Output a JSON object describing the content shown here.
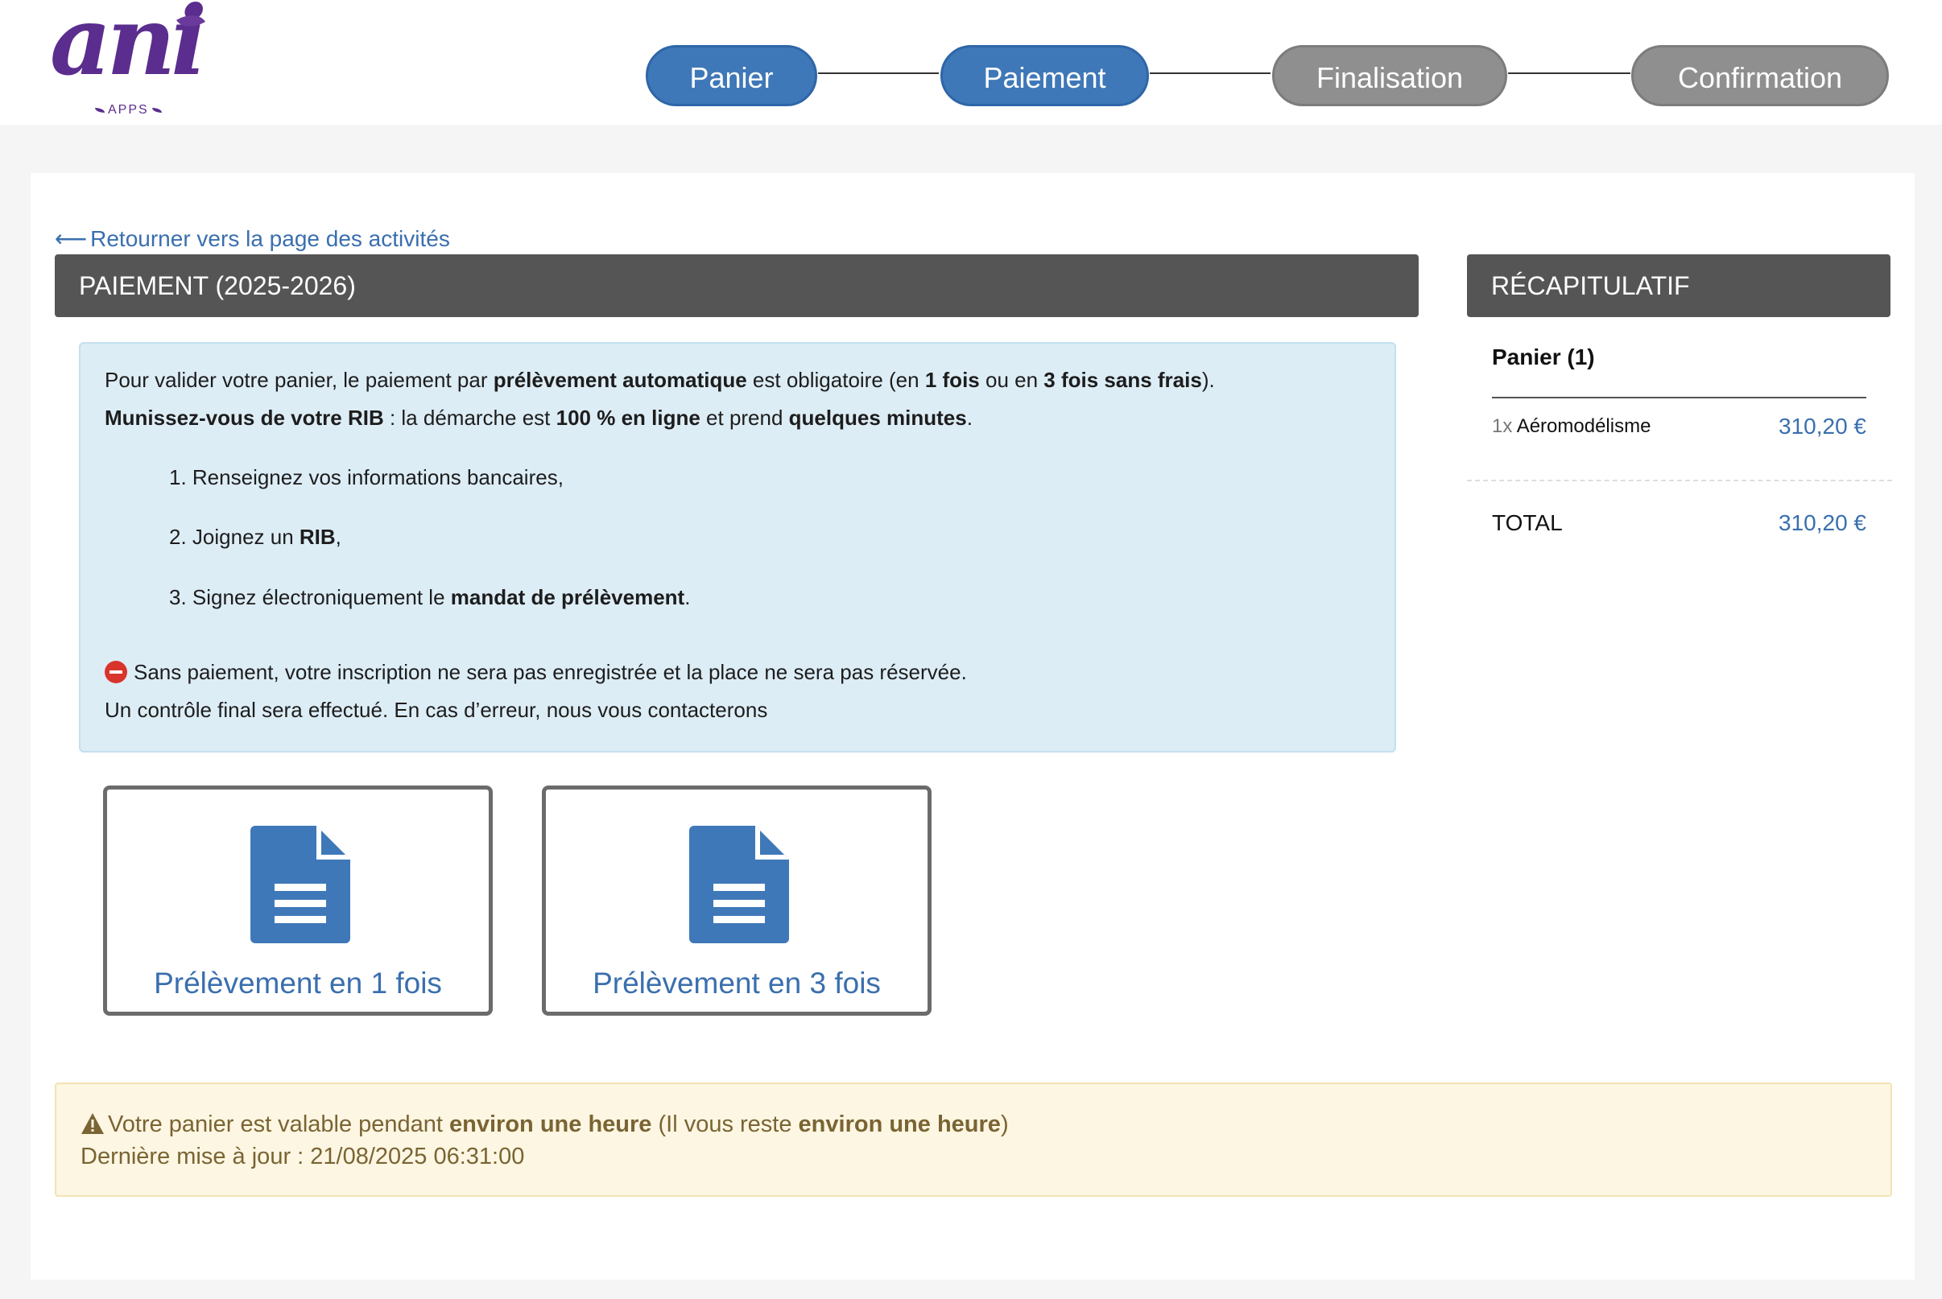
{
  "logo": {
    "text": "ani",
    "sub": "APPS"
  },
  "steps": [
    {
      "label": "Panier",
      "state": "active"
    },
    {
      "label": "Paiement",
      "state": "active"
    },
    {
      "label": "Finalisation",
      "state": "inactive"
    },
    {
      "label": "Confirmation",
      "state": "inactive"
    }
  ],
  "back_link": "Retourner vers la page des activités",
  "payment": {
    "title": "PAIEMENT (2025-2026)",
    "info": {
      "line1": [
        "Pour valider votre panier, le paiement par ",
        "prélèvement automatique",
        " est obligatoire (en ",
        "1 fois",
        " ou en ",
        "3 fois sans frais",
        ")."
      ],
      "line2": [
        "Munissez-vous de votre RIB",
        " : la démarche est ",
        "100 % en ligne",
        " et prend ",
        "quelques minutes",
        "."
      ],
      "step1": "1. Renseignez vos informations bancaires,",
      "step2": [
        "2. Joignez un ",
        "RIB",
        ","
      ],
      "step3": [
        "3. Signez électroniquement le ",
        "mandat de prélèvement",
        "."
      ],
      "warning": "Sans paiement, votre inscription ne sera pas enregistrée et la place ne sera pas réservée.",
      "control": "Un contrôle final sera effectué. En cas d’erreur, nous vous contacterons"
    },
    "options": [
      {
        "label": "Prélèvement en 1 fois",
        "icon": "document-icon"
      },
      {
        "label": "Prélèvement en 3 fois",
        "icon": "document-icon"
      }
    ]
  },
  "summary": {
    "title": "RÉCAPITULATIF",
    "cart_label": "Panier (1)",
    "items": [
      {
        "qty": "1x",
        "name": "Aéromodélisme",
        "price": "310,20 €"
      }
    ],
    "total_label": "TOTAL",
    "total_value": "310,20 €"
  },
  "notice": {
    "line1": [
      "Votre panier est valable pendant ",
      "environ une heure",
      " (Il vous reste ",
      "environ une heure",
      ")"
    ],
    "line2": "Dernière mise à jour : 21/08/2025 06:31:00"
  },
  "colors": {
    "accent": "#3f78b8",
    "inactive": "#8f8f8f",
    "brand": "#5b2d8e"
  }
}
